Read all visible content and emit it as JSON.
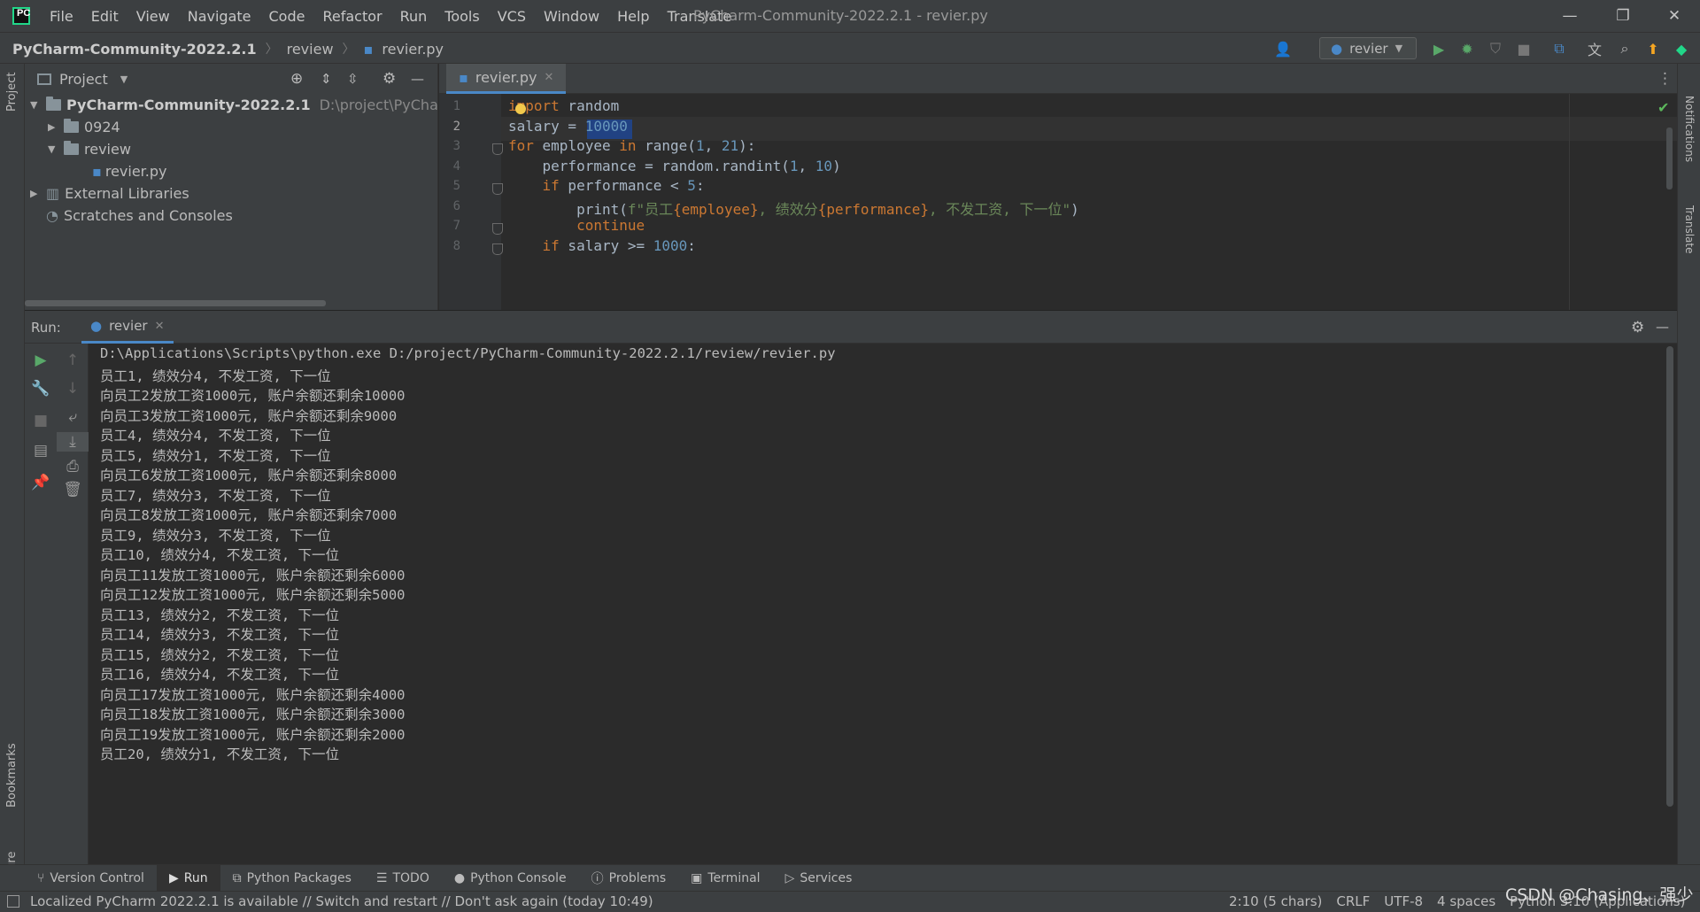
{
  "menu": [
    "File",
    "Edit",
    "View",
    "Navigate",
    "Code",
    "Refactor",
    "Run",
    "Tools",
    "VCS",
    "Window",
    "Help",
    "Translate"
  ],
  "window_title": "PyCharm-Community-2022.2.1 - revier.py",
  "breadcrumbs": [
    "PyCharm-Community-2022.2.1",
    "review",
    "revier.py"
  ],
  "run_config": "revier",
  "project": {
    "header_label": "Project",
    "tree": [
      {
        "label": "PyCharm-Community-2022.2.1",
        "path": "D:\\project\\PyCharm"
      },
      {
        "label": "0924"
      },
      {
        "label": "review"
      },
      {
        "label": "revier.py"
      },
      {
        "label": "External Libraries"
      },
      {
        "label": "Scratches and Consoles"
      }
    ]
  },
  "editor": {
    "tab_label": "revier.py",
    "line_numbers": [
      "1",
      "2",
      "3",
      "4",
      "5",
      "6",
      "7",
      "8"
    ],
    "code": {
      "l1_kw": "import",
      "l1_rest": " random",
      "l2_a": "salary = ",
      "l2_num": "10000",
      "l3_kw1": "for",
      "l3_a": " employee ",
      "l3_kw2": "in",
      "l3_b": " range(",
      "l3_n1": "1",
      "l3_c": ", ",
      "l3_n2": "21",
      "l3_d": "):",
      "l4_a": "    performance = random.randint(",
      "l4_n1": "1",
      "l4_b": ", ",
      "l4_n2": "10",
      "l4_c": ")",
      "l5_kw": "    if",
      "l5_a": " performance < ",
      "l5_num": "5",
      "l5_b": ":",
      "l6_a": "        print(",
      "l6_s1": "f\"员工",
      "l6_v1": "{employee}",
      "l6_s2": ", 绩效分",
      "l6_v2": "{performance}",
      "l6_s3": ", 不发工资, 下一位\"",
      "l6_b": ")",
      "l7_kw": "        continue",
      "l8_kw": "    if",
      "l8_a": " salary >= ",
      "l8_num": "1000",
      "l8_b": ":"
    }
  },
  "run": {
    "label": "Run:",
    "tab": "revier",
    "console": [
      "D:\\Applications\\Scripts\\python.exe D:/project/PyCharm-Community-2022.2.1/review/revier.py",
      "员工1, 绩效分4, 不发工资, 下一位",
      "向员工2发放工资1000元, 账户余额还剩余10000",
      "向员工3发放工资1000元, 账户余额还剩余9000",
      "员工4, 绩效分4, 不发工资, 下一位",
      "员工5, 绩效分1, 不发工资, 下一位",
      "向员工6发放工资1000元, 账户余额还剩余8000",
      "员工7, 绩效分3, 不发工资, 下一位",
      "向员工8发放工资1000元, 账户余额还剩余7000",
      "员工9, 绩效分3, 不发工资, 下一位",
      "员工10, 绩效分4, 不发工资, 下一位",
      "向员工11发放工资1000元, 账户余额还剩余6000",
      "向员工12发放工资1000元, 账户余额还剩余5000",
      "员工13, 绩效分2, 不发工资, 下一位",
      "员工14, 绩效分3, 不发工资, 下一位",
      "员工15, 绩效分2, 不发工资, 下一位",
      "员工16, 绩效分4, 不发工资, 下一位",
      "向员工17发放工资1000元, 账户余额还剩余4000",
      "向员工18发放工资1000元, 账户余额还剩余3000",
      "向员工19发放工资1000元, 账户余额还剩余2000",
      "员工20, 绩效分1, 不发工资, 下一位"
    ]
  },
  "left_strip": {
    "project": "Project",
    "bookmarks": "Bookmarks",
    "structure": "Structure"
  },
  "right_strip": {
    "notifications": "Notifications",
    "translate": "Translate"
  },
  "bottom_tools": [
    "Version Control",
    "Run",
    "Python Packages",
    "TODO",
    "Python Console",
    "Problems",
    "Terminal",
    "Services"
  ],
  "status": {
    "message": "Localized PyCharm 2022.2.1 is available // Switch and restart // Don't ask again (today 10:49)",
    "position": "2:10 (5 chars)",
    "line_sep": "CRLF",
    "encoding": "UTF-8",
    "indent": "4 spaces",
    "interpreter": "Python 3.10 (Applications)"
  },
  "watermark": "CSDN @Chasing、强少"
}
